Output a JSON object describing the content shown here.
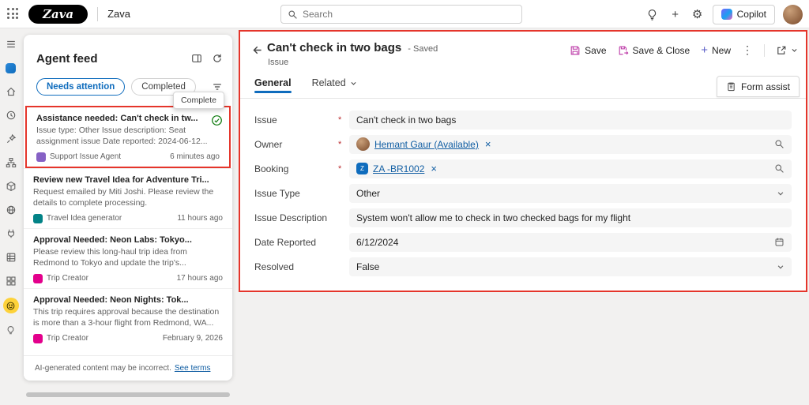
{
  "colors": {
    "accent_blue": "#0f6cbd",
    "annotation_red": "#e5352b",
    "command_magenta": "#bb35a5",
    "success_green": "#107c10",
    "highlight_yellow": "#fdd23a",
    "link_blue": "#115ea3"
  },
  "glyphs": {
    "gear": "⚙",
    "ellipsis": "⋮",
    "plus": "+",
    "close": "×"
  },
  "topbar": {
    "logo_text": "Zava",
    "app_name": "Zava",
    "search_placeholder": "Search",
    "copilot_label": "Copilot"
  },
  "rail_icons": [
    "menu",
    "app-home",
    "home",
    "recent",
    "pinned",
    "hierarchy",
    "products",
    "web",
    "connectors",
    "tables",
    "apps",
    "agent-feed",
    "insights"
  ],
  "feed": {
    "title": "Agent feed",
    "filters": [
      {
        "label": "Needs attention"
      },
      {
        "label": "Completed"
      }
    ],
    "tooltip": "Complete",
    "items": [
      {
        "title": "Assistance needed: Can't check in tw...",
        "body": "Issue type: Other Issue description: Seat assignment issue Date reported: 2024-06-12...",
        "agent": "Support Issue Agent",
        "time": "6 minutes ago"
      },
      {
        "title": "Review new Travel Idea for Adventure Tri...",
        "body": "Request emailed by Miti Joshi. Please review the details to complete processing.",
        "agent": "Travel Idea generator",
        "time": "11 hours ago"
      },
      {
        "title": "Approval Needed: Neon Labs: Tokyo...",
        "body": "Please review this long-haul trip idea from Redmond to Tokyo and update the trip's...",
        "agent": "Trip Creator",
        "time": "17 hours ago"
      },
      {
        "title": "Approval Needed: Neon Nights: Tok...",
        "body": "This trip requires approval because the destination is more than a 3-hour flight from Redmond, WA...",
        "agent": "Trip Creator",
        "time": "February 9, 2026"
      }
    ],
    "footer_text": "AI-generated content may be incorrect.",
    "footer_link": "See terms"
  },
  "main": {
    "title": "Can't check in two bags",
    "status": "- Saved",
    "entity": "Issue",
    "tabs": [
      {
        "label": "General"
      },
      {
        "label": "Related"
      }
    ],
    "commands": {
      "save": "Save",
      "save_close": "Save & Close",
      "new": "New"
    },
    "form_assist": "Form assist",
    "fields": [
      {
        "label": "Issue",
        "value": "Can't check in two bags"
      },
      {
        "label": "Owner",
        "value": "Hemant Gaur (Available)"
      },
      {
        "label": "Booking",
        "value": "ZA -BR1002"
      },
      {
        "label": "Issue Type",
        "value": "Other"
      },
      {
        "label": "Issue Description",
        "value": "System won't allow me to check in two checked bags for my flight"
      },
      {
        "label": "Date Reported",
        "value": "6/12/2024"
      },
      {
        "label": "Resolved",
        "value": "False"
      }
    ]
  }
}
